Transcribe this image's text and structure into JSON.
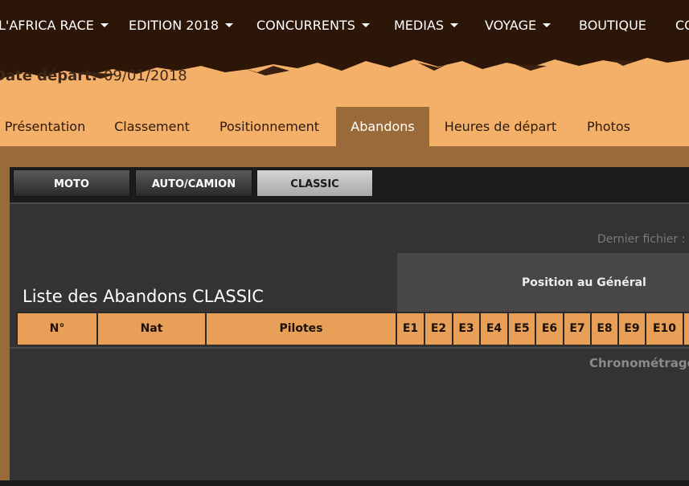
{
  "topnav": {
    "items": [
      {
        "label": "L'AFRICA RACE",
        "dropdown": true
      },
      {
        "label": "EDITION 2018",
        "dropdown": true
      },
      {
        "label": "CONCURRENTS",
        "dropdown": true
      },
      {
        "label": "MEDIAS",
        "dropdown": true
      },
      {
        "label": "VOYAGE",
        "dropdown": true
      },
      {
        "label": "BOUTIQUE",
        "dropdown": false
      },
      {
        "label": "CO",
        "dropdown": false
      }
    ]
  },
  "header": {
    "date_label": "Date départ:",
    "date_value": "09/01/2018"
  },
  "tabs": [
    {
      "label": "Présentation",
      "active": false
    },
    {
      "label": "Classement",
      "active": false
    },
    {
      "label": "Positionnement",
      "active": false
    },
    {
      "label": "Abandons",
      "active": true
    },
    {
      "label": "Heures de départ",
      "active": false
    },
    {
      "label": "Photos",
      "active": false
    }
  ],
  "subtabs": [
    {
      "label": "MOTO",
      "active": false
    },
    {
      "label": "AUTO/CAMION",
      "active": false
    },
    {
      "label": "CLASSIC",
      "active": true
    }
  ],
  "content": {
    "last_file": "Dernier fichier : (",
    "position_header": "Position au Général",
    "list_title": "Liste des Abandons CLASSIC",
    "chrono": "Chronométrage"
  },
  "table": {
    "columns": [
      "N°",
      "Nat",
      "Pilotes",
      "E1",
      "E2",
      "E3",
      "E4",
      "E5",
      "E6",
      "E7",
      "E8",
      "E9",
      "E10"
    ]
  },
  "colors": {
    "nav_bg": "#2b1608",
    "band": "#f4b068",
    "active_tab": "#9a6a3a",
    "header_cell": "#e8a058",
    "panel": "#333333"
  }
}
